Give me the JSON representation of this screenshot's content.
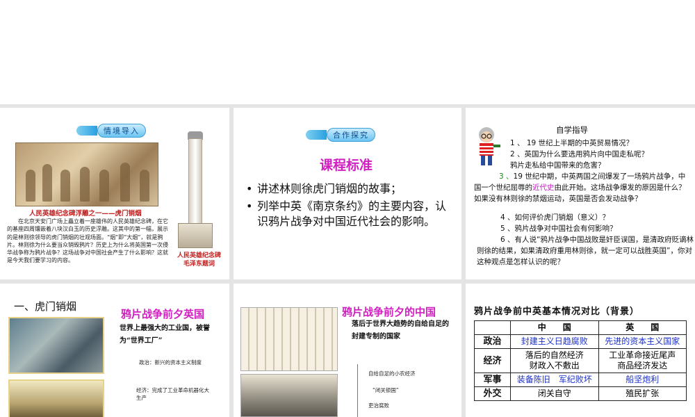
{
  "slide1": {
    "badge": "情境导入",
    "relief_caption": "人民英雄纪念碑浮雕之一——虎门销烟",
    "body": "在北京天安门广场上矗立着一座雄伟的人民英雄纪念碑，在它的基座四周镶嵌着八块汉白玉的历史浮雕。这其中的第一幅，展示的是林则徐领导的虎门销烟的壮观场面。“烟”即“大烟”，就是鸦片。林则徐为什么要当众销毁鸦片？历史上为什么将英国第一次侵华战争称为鸦片战争？这场战争对中国社会产生了什么影响？这就是今天我们要学习的内容。",
    "monument_caption_1": "人民英雄纪念碑",
    "monument_caption_2": "毛泽东题词"
  },
  "slide2": {
    "badge": "合作探究",
    "title": "课程标准",
    "bullets": [
      "讲述林则徐虎门销烟的故事；",
      "列举中英《南京条约》的主要内容，认识鸦片战争对中国近代社会的影响。"
    ]
  },
  "slide3": {
    "title": "自学指导",
    "q1": "1 、 19 世纪上半期的中英贸易情况？",
    "q2": "2 、英国为什么要选用鸦片向中国走私呢？",
    "q2b": "鸦片走私给中国带来的危害？",
    "q3_num": "3 、",
    "q3_a": "19 世纪中期，中英两国之间爆发了一场鸦片战争，中国一个世纪屈辱的",
    "q3_highlight": "近代史",
    "q3_b": "由此开始。这场战争爆发的原因是什么？如果没有林则徐的禁烟运动，英国是否会发动战争？",
    "q4": "4 、如何评价虎门销烟（意义）？",
    "q5": "5 、鸦片战争对中国社会有何影响？",
    "q6": "6 、有人说“鸦片战争中国战败是奸臣误国，是清政府贬谪林则徐的结果，如果清政府重用林则徐，就一定可以战胜英国”，你对这种观点是怎样认识的呢？",
    "colors": {
      "q3_num": "#1a8a1a",
      "highlight": "#c020c0"
    }
  },
  "slide4": {
    "heading": "一、虎门销烟",
    "title": "鸦片战争前夕英国",
    "subtitle": "世界上最强大的工业国，被誉为“世界工厂”",
    "note1": "政治：新兴的资本主义制度",
    "note2": "经济：完成了工业革命机器化大生产"
  },
  "slide5": {
    "title": "鸦片战争前夕的中国",
    "subtitle": "落后于世界大趋势的自给自足的封建专制的国家",
    "note1": "自给自足的小农经济",
    "note2": "“闭关锁国”",
    "note3": "吏治腐败"
  },
  "slide6": {
    "title": "鸦片战争前中英基本情况对比（背景）",
    "col_china": "中　　国",
    "col_britain": "英　　国",
    "rows": [
      {
        "label": "政治",
        "china": "封建主义日趋腐败",
        "britain": "先进的资本主义国家"
      },
      {
        "label": "经济",
        "china": "落后的自然经济\n财政入不敷出",
        "britain": "工业革命接近尾声\n商品经济发达"
      },
      {
        "label": "军事",
        "china": "装备陈旧　军纪败坏",
        "britain": "船坚炮利"
      },
      {
        "label": "外交",
        "china": "闭关自守",
        "britain": "殖民扩张"
      }
    ]
  }
}
